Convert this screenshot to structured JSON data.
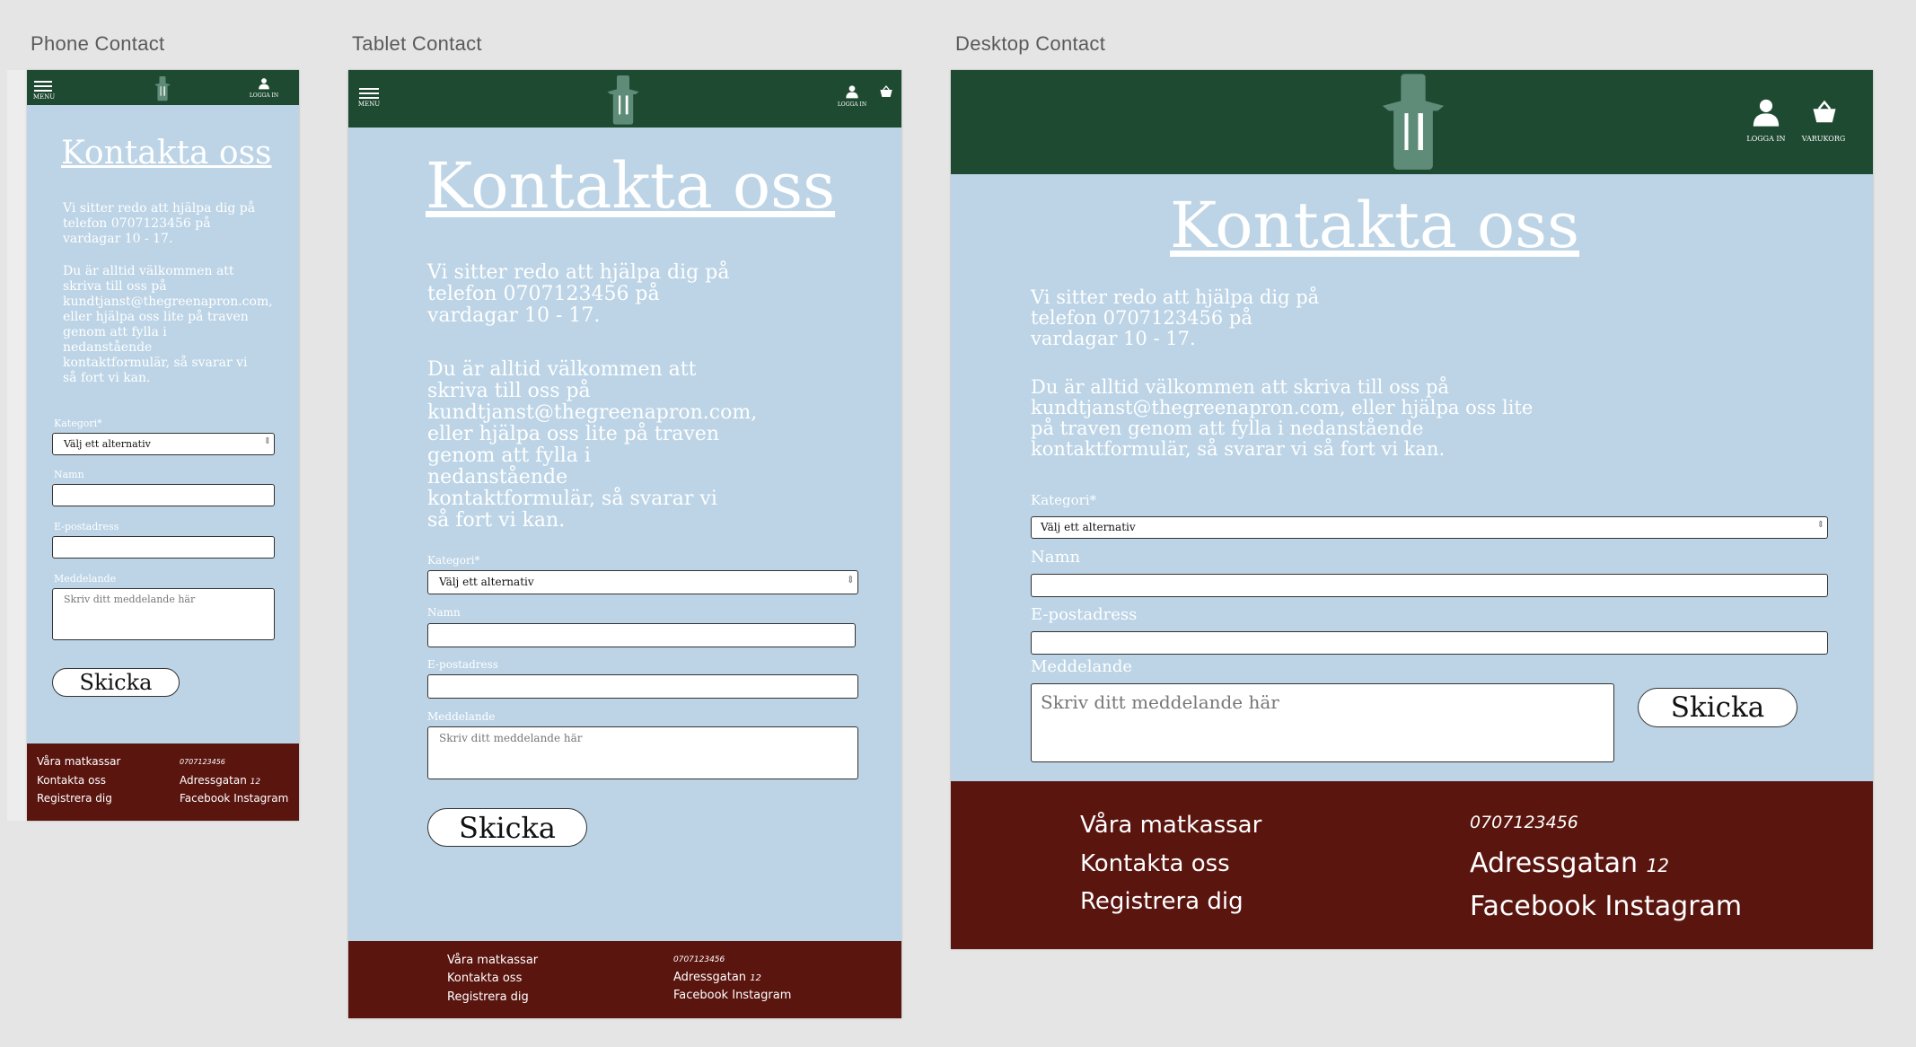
{
  "frames": {
    "phone_title": "Phone Contact",
    "tablet_title": "Tablet Contact",
    "desktop_title": "Desktop Contact"
  },
  "header": {
    "menu_label": "MENU",
    "login_label": "LOGGA IN",
    "cart_label": "VARUKORG",
    "logo_icon": "apron-fork-knife-icon"
  },
  "page": {
    "heading": "Kontakta oss",
    "intro_phone": "Vi sitter redo att hjälpa dig på\ntelefon 0707123456 på\nvardagar 10 - 17.",
    "intro_tablet": "Vi sitter redo att hjälpa dig på\ntelefon 0707123456 på\nvardagar 10 - 17.",
    "intro_desktop": "Vi sitter redo att hjälpa dig på\ntelefon 0707123456 på\nvardagar 10 - 17.",
    "body_phone": "Du är alltid välkommen att\nskriva till oss på\nkundtjanst@thegreenapron.com,\neller hjälpa oss lite på traven\ngenom att fylla i\nnedanstående\nkontaktformulär, så svarar vi\nså fort vi kan.",
    "body_tablet": "Du är alltid välkommen att\nskriva till oss på\nkundtjanst@thegreenapron.com,\neller hjälpa oss lite på traven\ngenom att fylla i\nnedanstående\nkontaktformulär, så svarar vi\nså fort vi kan.",
    "body_desktop": "Du är alltid välkommen att skriva till oss på\nkundtjanst@thegreenapron.com, eller hjälpa oss lite\npå traven genom att fylla i nedanstående\nkontaktformulär, så svarar vi så fort vi kan."
  },
  "form": {
    "category_label": "Kategori*",
    "category_value": "Välj ett alternativ",
    "name_label": "Namn",
    "email_label": "E-postadress",
    "message_label": "Meddelande",
    "message_placeholder": "Skriv ditt meddelande här",
    "submit_label": "Skicka"
  },
  "footer": {
    "link_1": "Våra matkassar",
    "link_2": "Kontakta oss",
    "link_3": "Registrera dig",
    "phone": "0707123456",
    "address_street": "Adressgatan",
    "address_number": "12",
    "social_1": "Facebook",
    "social_2": "Instagram"
  },
  "colors": {
    "header_green": "#1f4a32",
    "page_blue": "#bcd4e6",
    "footer_red": "#5a150f",
    "apron_green": "#5e8c78"
  }
}
